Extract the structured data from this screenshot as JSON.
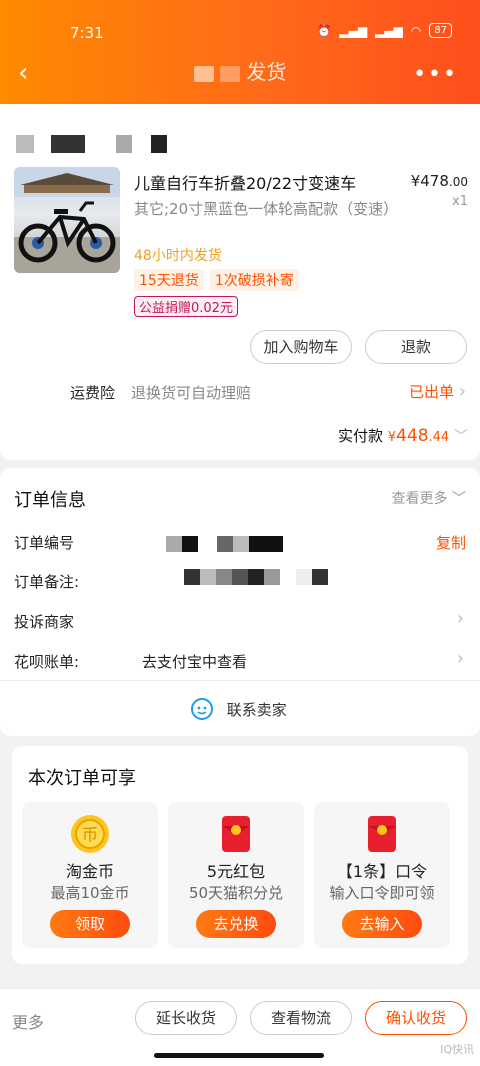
{
  "status": {
    "time": "7:31",
    "battery": "87"
  },
  "nav": {
    "title": "发货",
    "back_icon": "‹",
    "more_icon": "•••"
  },
  "product": {
    "title": "儿童自行车折叠20/22寸变速车",
    "price_symbol": "¥",
    "price_int": "478",
    "price_dec": ".00",
    "qty": "x1",
    "spec": "其它;20寸黑蓝色一体轮高配款（变速）",
    "ship": "48小时内发货",
    "tags": [
      "15天退货",
      "1次破损补寄"
    ],
    "charity": "公益捐赠0.02元"
  },
  "actions": {
    "add_cart": "加入购物车",
    "refund": "退款"
  },
  "insurance": {
    "label": "运费险",
    "desc": "退换货可自动理赔",
    "status": "已出单"
  },
  "payment": {
    "label": "实付款",
    "symbol": "¥",
    "int": "448",
    "dec": ".44"
  },
  "order": {
    "title": "订单信息",
    "see_more": "查看更多",
    "number_label": "订单编号",
    "copy": "复制",
    "remark_label": "订单备注:",
    "complain": "投诉商家",
    "huabei_label": "花呗账单:",
    "huabei_value": "去支付宝中查看",
    "contact": "联系卖家"
  },
  "benefits": {
    "title": "本次订单可享",
    "items": [
      {
        "name": "淘金币",
        "desc": "最高10金币",
        "button": "领取",
        "icon": "gold-coin-icon"
      },
      {
        "name": "5元红包",
        "desc": "50天猫积分兑",
        "button": "去兑换",
        "icon": "red-packet-icon"
      },
      {
        "name": "【1条】口令",
        "desc": "输入口令即可领",
        "button": "去输入",
        "icon": "red-packet-icon"
      }
    ]
  },
  "bottom": {
    "more": "更多",
    "extend": "延长收货",
    "logistics": "查看物流",
    "confirm": "确认收货"
  },
  "watermark": "IQ快讯",
  "colors": {
    "accent": "#ff5000",
    "header_start": "#ff8a00",
    "header_end": "#ff4e1c"
  }
}
